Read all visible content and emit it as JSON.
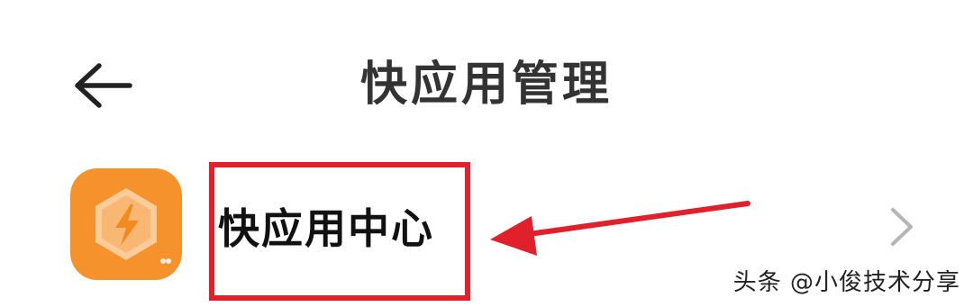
{
  "header": {
    "back_icon": "back-arrow-icon",
    "title": "快应用管理"
  },
  "list": {
    "items": [
      {
        "icon": "quick-app-lightning-icon",
        "icon_color": "#F5922B",
        "label": "快应用中心",
        "trailing_icon": "chevron-right-icon"
      }
    ]
  },
  "annotation": {
    "highlight_color": "#E0202A",
    "arrow_icon": "red-pointer-arrow-icon"
  },
  "watermark": {
    "text": "头条 @小俊技术分享"
  }
}
